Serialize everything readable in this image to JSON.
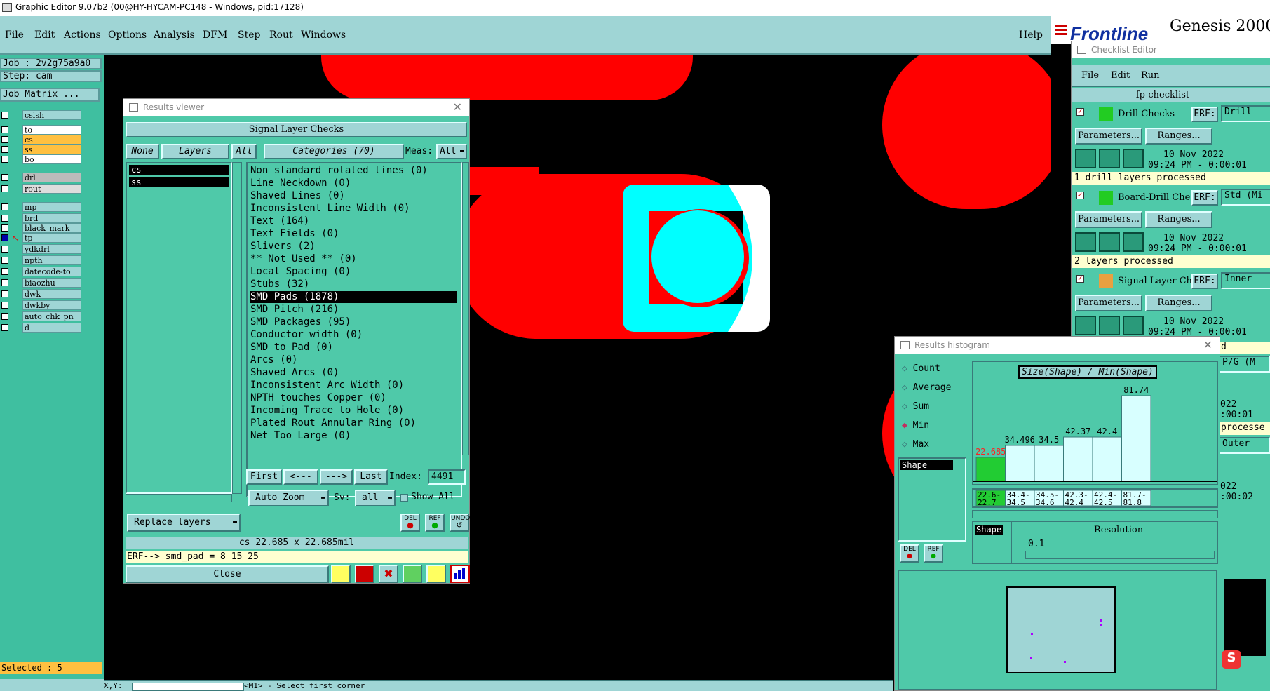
{
  "window_title": "Graphic Editor 9.07b2 (00@HY-HYCAM-PC148 - Windows, pid:17128)",
  "menu": [
    "File",
    "Edit",
    "Actions",
    "Options",
    "Analysis",
    "DFM",
    "Step",
    "Rout",
    "Windows"
  ],
  "help": "Help",
  "brand": {
    "logo": "Frontline",
    "product": "Genesis 2000"
  },
  "left": {
    "job": "Job : 2v2g75a9a0",
    "step": "Step: cam",
    "job_matrix": "Job Matrix ...",
    "layers": [
      "cslsh",
      "to",
      "cs",
      "ss",
      "bo",
      "drl",
      "rout",
      "mp",
      "brd",
      "black_mark",
      "tp",
      "ydkdrl",
      "npth",
      "datecode-to",
      "biaozhu",
      "dwk",
      "dwkby",
      "auto_chk_pn",
      "d"
    ],
    "selected": "Selected : 5"
  },
  "results_viewer": {
    "title": "Results viewer",
    "header": "Signal Layer Checks",
    "tabs": {
      "none": "None",
      "layers": "Layers",
      "all": "All"
    },
    "categories_label": "Categories (70)",
    "meas_label": "Meas:",
    "meas_value": "All",
    "layer_list": [
      "cs",
      "ss"
    ],
    "categories": [
      "Non standard rotated lines (0)",
      "Line Neckdown (0)",
      "Shaved Lines (0)",
      "Inconsistent Line Width (0)",
      "Text (164)",
      "Text Fields (0)",
      "Slivers (2)",
      "** Not Used ** (0)",
      "Local Spacing (0)",
      "Stubs (32)",
      "SMD Pads (1878)",
      "SMD Pitch (216)",
      "SMD Packages (95)",
      "Conductor width (0)",
      "SMD to Pad (0)",
      "Arcs (0)",
      "Shaved Arcs (0)",
      "Inconsistent Arc Width (0)",
      "NPTH touches Copper (0)",
      "Incoming Trace to Hole (0)",
      "Plated Rout Annular Ring (0)",
      "Net Too Large (0)"
    ],
    "selected_category": "SMD Pads (1878)",
    "nav": {
      "first": "First",
      "prev": "<---",
      "next": "--->",
      "last": "Last",
      "index_label": "Index:",
      "index_value": "4491"
    },
    "auto_zoom": "Auto Zoom",
    "sv_label": "Sv:",
    "sv_value": "all",
    "show_all": "Show All",
    "replace_layers": "Replace layers",
    "icons": [
      "DEL",
      "REF",
      "UNDO"
    ],
    "status": "cs 22.685 x 22.685mil",
    "erf": "ERF--> smd_pad = 8 15 25",
    "close": "Close"
  },
  "checklist": {
    "title": "Checklist Editor",
    "menu": [
      "File",
      "Edit",
      "Run"
    ],
    "name": "fp-checklist",
    "checks": [
      {
        "name": "Drill Checks",
        "erf": "ERF:",
        "erf_value": "Drill",
        "date": "10 Nov 2022",
        "time": "09:24 PM - 0:00:01",
        "status": "1 drill layers processed"
      },
      {
        "name": "Board-Drill Che",
        "erf": "ERF:",
        "erf_value": "Std (Mi",
        "date": "10 Nov 2022",
        "time": "09:24 PM - 0:00:01",
        "status": "2 layers processed"
      },
      {
        "name": "Signal Layer Ch",
        "erf": "ERF:",
        "erf_value": "Inner",
        "date": "10 Nov 2022",
        "time": "09:24 PM - 0:00:01",
        "status": "d"
      }
    ],
    "params": "Parameters...",
    "ranges": "Ranges...",
    "extra": [
      "P/G (M",
      "022",
      ":00:01",
      "processe",
      "Outer",
      "022",
      ":00:02"
    ]
  },
  "histogram": {
    "title": "Results histogram",
    "options": [
      "Count",
      "Average",
      "Sum",
      "Min",
      "Max"
    ],
    "selected_option": "Min",
    "chart_title": "Size(Shape) / Min(Shape)",
    "bar_labels": [
      "22.685",
      "34.496",
      "34.5",
      "42.37",
      "42.4",
      "81.74"
    ],
    "bins": [
      "22.6-\n22.7",
      "34.4-\n34.5",
      "34.5-\n34.6",
      "42.3-\n42.4",
      "42.4-\n42.5",
      "81.7-\n81.8"
    ],
    "shape_list": [
      "Shape"
    ],
    "shape_tag": "Shape",
    "resolution_label": "Resolution",
    "resolution_value": "0.1",
    "icons": [
      "DEL",
      "REF"
    ]
  },
  "bottom": {
    "prompt": "<M1> - Select first corner",
    "xy": "X,Y:"
  },
  "chart_data": {
    "type": "bar",
    "title": "Size(Shape) / Min(Shape)",
    "categories": [
      "22.6-22.7",
      "34.4-34.5",
      "34.5-34.6",
      "42.3-42.4",
      "42.4-42.5",
      "81.7-81.8"
    ],
    "values": [
      22.685,
      34.496,
      34.5,
      42.37,
      42.4,
      81.74
    ],
    "xlabel": "",
    "ylabel": ""
  },
  "colors": {
    "bg_teal": "#4fc9a9",
    "light_teal": "#9fd5d5",
    "copper_red": "#ff0000",
    "pad_cyan": "#00ffff",
    "orange": "#ffc040"
  }
}
